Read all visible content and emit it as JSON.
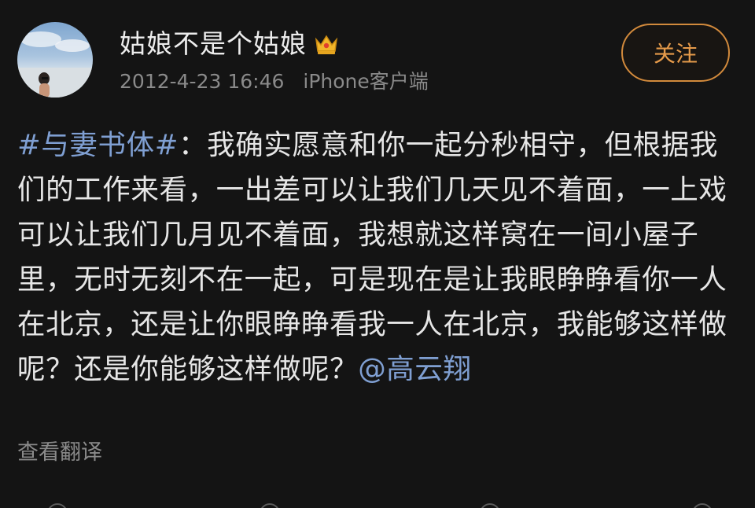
{
  "post": {
    "username": "姑娘不是个姑娘",
    "badge_icon": "crown-icon",
    "timestamp": "2012-4-23 16:46",
    "source": "iPhone客户端",
    "follow_label": "关注",
    "hashtag": "#与妻书体#",
    "body_text": "：我确实愿意和你一起分秒相守，但根据我们的工作来看，一出差可以让我们几天见不着面，一上戏可以让我们几月见不着面，我想就这样窝在一间小屋子里，无时无刻不在一起，可是现在是让我眼睁睁看你一人在北京，还是让你眼睁睁看我一人在北京，我能够这样做呢？还是你能够这样做呢？",
    "mention": "@高云翔",
    "translate_label": "查看翻译"
  },
  "colors": {
    "background": "#141414",
    "link": "#7f9fd2",
    "follow_accent": "#e59a4a",
    "meta_gray": "#8a8a8a"
  }
}
